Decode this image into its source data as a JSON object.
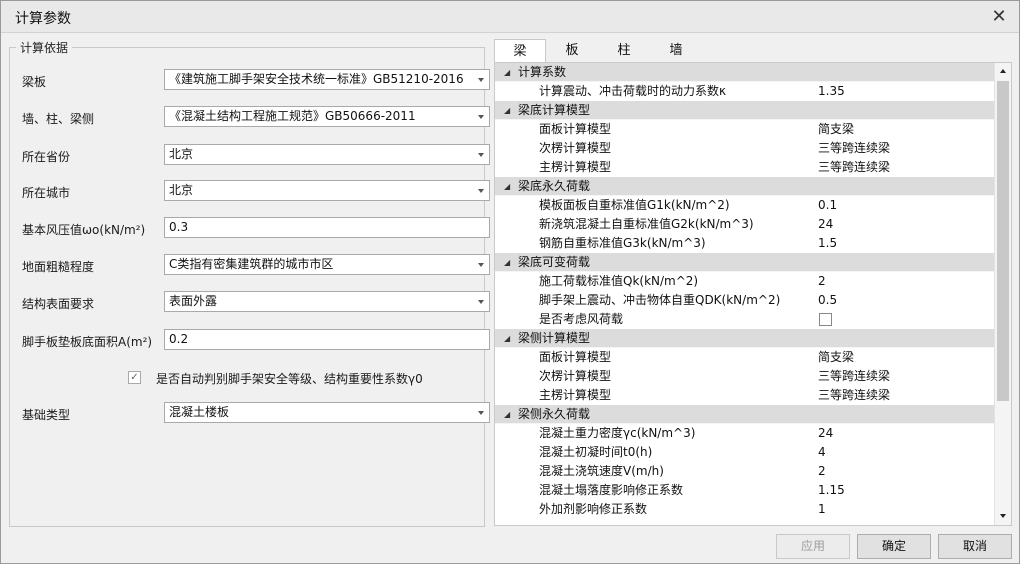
{
  "window": {
    "title": "计算参数"
  },
  "basis": {
    "legend": "计算依据",
    "fields": [
      {
        "label": "梁板",
        "value": "《建筑施工脚手架安全技术统一标准》GB51210-2016",
        "type": "select"
      },
      {
        "label": "墙、柱、梁侧",
        "value": "《混凝土结构工程施工规范》GB50666-2011",
        "type": "select"
      },
      {
        "label": "所在省份",
        "value": "北京",
        "type": "select"
      },
      {
        "label": "所在城市",
        "value": "北京",
        "type": "select"
      },
      {
        "label": "基本风压值ωo(kN/m²)",
        "value": "0.3",
        "type": "input"
      },
      {
        "label": "地面粗糙程度",
        "value": "C类指有密集建筑群的城市市区",
        "type": "select"
      },
      {
        "label": "结构表面要求",
        "value": "表面外露",
        "type": "select"
      },
      {
        "label": "脚手板垫板底面积A(m²)",
        "value": "0.2",
        "type": "input"
      }
    ],
    "auto_check": {
      "checked": true,
      "label": "是否自动判别脚手架安全等级、结构重要性系数γ0"
    },
    "foundation": {
      "label": "基础类型",
      "value": "混凝土楼板"
    }
  },
  "tabs": [
    "梁",
    "板",
    "柱",
    "墙"
  ],
  "active_tab": "梁",
  "grid_rows": [
    {
      "kind": "cat",
      "name": "计算系数"
    },
    {
      "kind": "prop",
      "name": "计算震动、冲击荷载时的动力系数κ",
      "value": "1.35"
    },
    {
      "kind": "cat",
      "name": "梁底计算模型"
    },
    {
      "kind": "prop",
      "name": "面板计算模型",
      "value": "简支梁"
    },
    {
      "kind": "prop",
      "name": "次楞计算模型",
      "value": "三等跨连续梁"
    },
    {
      "kind": "prop",
      "name": "主楞计算模型",
      "value": "三等跨连续梁"
    },
    {
      "kind": "cat",
      "name": "梁底永久荷载"
    },
    {
      "kind": "prop",
      "name": "模板面板自重标准值G1k(kN/m^2)",
      "value": "0.1"
    },
    {
      "kind": "prop",
      "name": "新浇筑混凝土自重标准值G2k(kN/m^3)",
      "value": "24"
    },
    {
      "kind": "prop",
      "name": "钢筋自重标准值G3k(kN/m^3)",
      "value": "1.5"
    },
    {
      "kind": "cat",
      "name": "梁底可变荷载"
    },
    {
      "kind": "prop",
      "name": "施工荷载标准值Qk(kN/m^2)",
      "value": "2"
    },
    {
      "kind": "prop",
      "name": "脚手架上震动、冲击物体自重QDK(kN/m^2)",
      "value": "0.5"
    },
    {
      "kind": "check",
      "name": "是否考虑风荷载",
      "checked": false
    },
    {
      "kind": "cat",
      "name": "梁侧计算模型"
    },
    {
      "kind": "prop",
      "name": "面板计算模型",
      "value": "简支梁"
    },
    {
      "kind": "prop",
      "name": "次楞计算模型",
      "value": "三等跨连续梁"
    },
    {
      "kind": "prop",
      "name": "主楞计算模型",
      "value": "三等跨连续梁"
    },
    {
      "kind": "cat",
      "name": "梁侧永久荷载"
    },
    {
      "kind": "prop",
      "name": "混凝土重力密度γc(kN/m^3)",
      "value": "24"
    },
    {
      "kind": "prop",
      "name": "混凝土初凝时间t0(h)",
      "value": "4"
    },
    {
      "kind": "prop",
      "name": "混凝土浇筑速度V(m/h)",
      "value": "2"
    },
    {
      "kind": "prop",
      "name": "混凝土塌落度影响修正系数",
      "value": "1.15"
    },
    {
      "kind": "prop",
      "name": "外加剂影响修正系数",
      "value": "1"
    }
  ],
  "buttons": {
    "apply": "应用",
    "ok": "确定",
    "cancel": "取消"
  }
}
